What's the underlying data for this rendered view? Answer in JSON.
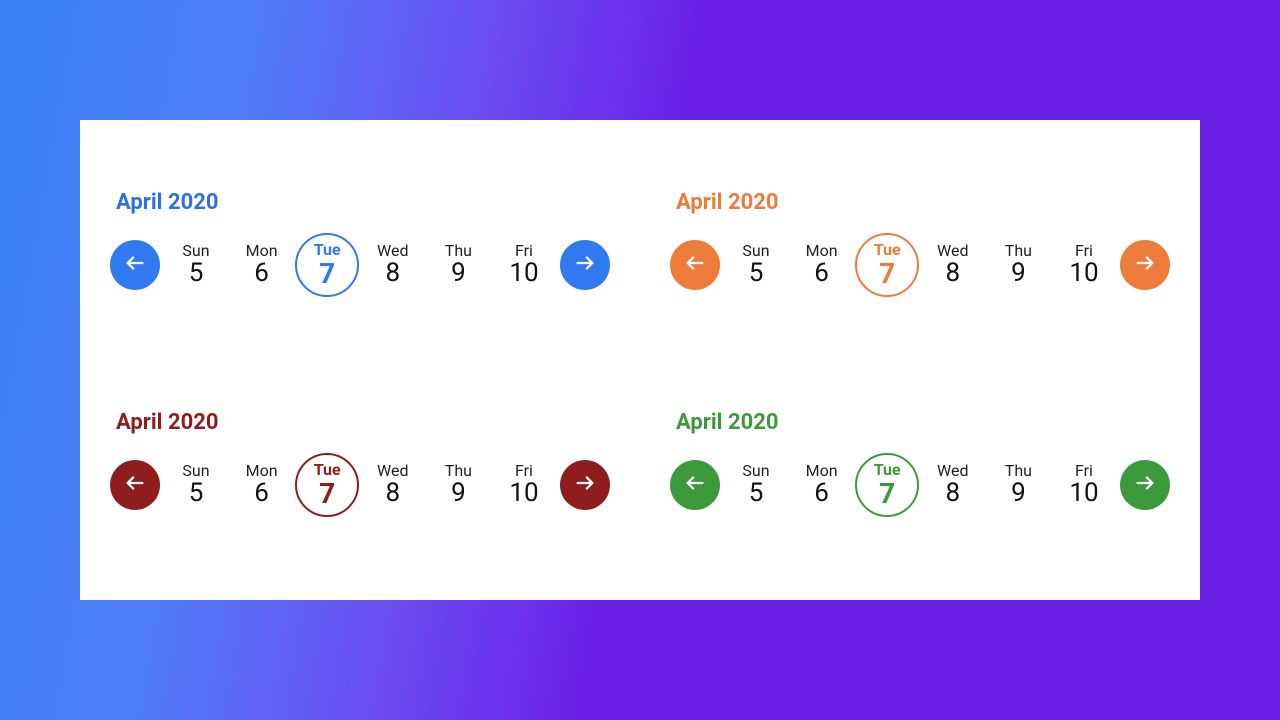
{
  "pickers": [
    {
      "variant": "blue",
      "title": "April 2020"
    },
    {
      "variant": "orange",
      "title": "April 2020"
    },
    {
      "variant": "maroon",
      "title": "April 2020"
    },
    {
      "variant": "green",
      "title": "April 2020"
    }
  ],
  "days": [
    {
      "dow": "Sun",
      "num": "5",
      "selected": false
    },
    {
      "dow": "Mon",
      "num": "6",
      "selected": false
    },
    {
      "dow": "Tue",
      "num": "7",
      "selected": true
    },
    {
      "dow": "Wed",
      "num": "8",
      "selected": false
    },
    {
      "dow": "Thu",
      "num": "9",
      "selected": false
    },
    {
      "dow": "Fri",
      "num": "10",
      "selected": false
    }
  ],
  "colors": {
    "blue": "#2f7af0",
    "orange": "#ed7b3a",
    "maroon": "#8f1d1d",
    "green": "#3c9a3c"
  }
}
